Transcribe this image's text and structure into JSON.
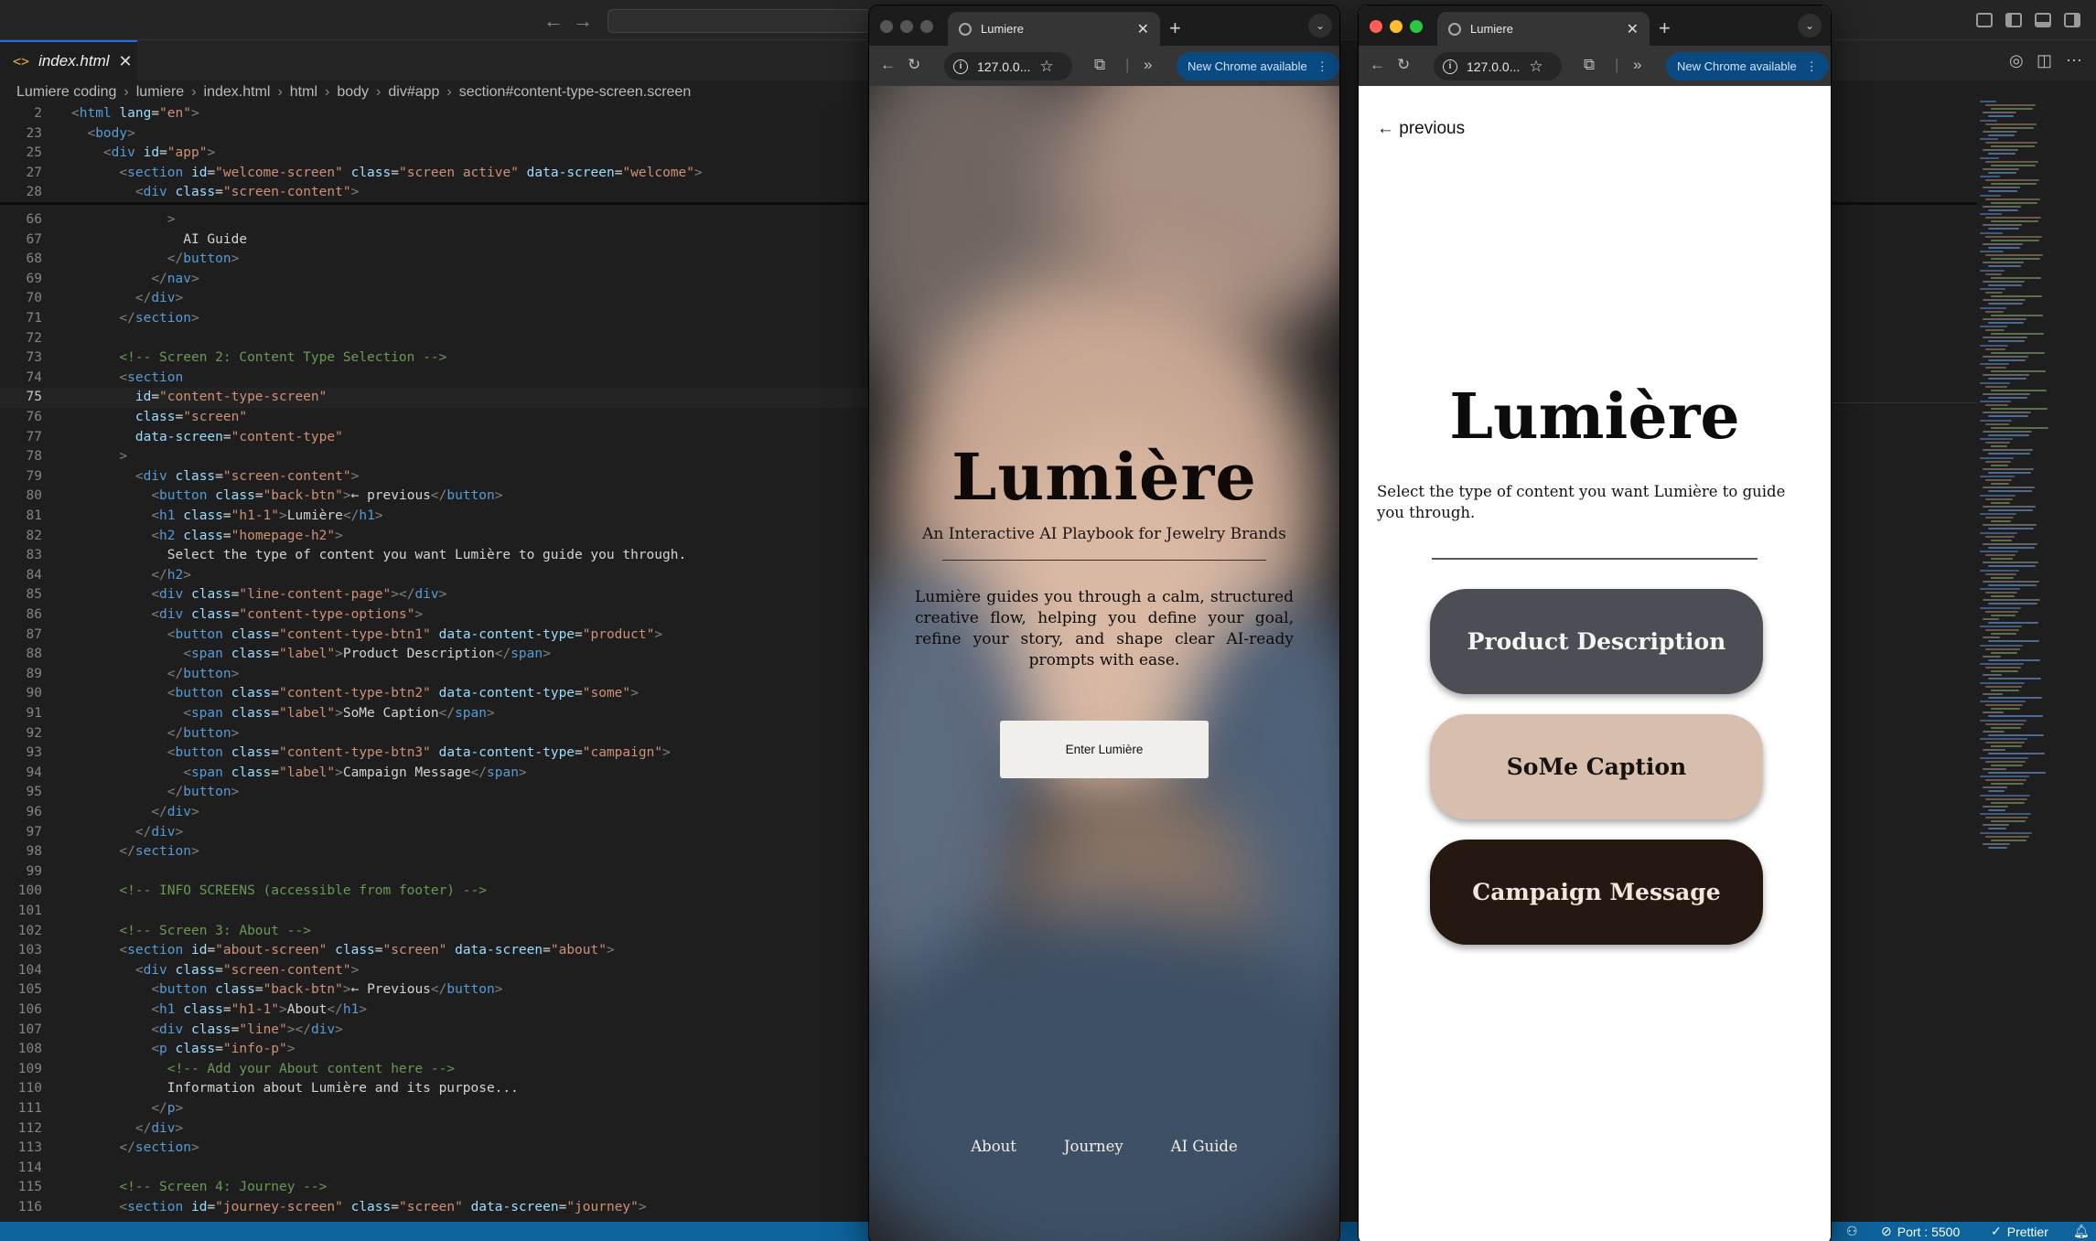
{
  "editor": {
    "tab_label": "index.html",
    "tab_file_icon": "<>",
    "tab_close": "✕",
    "breadcrumb": [
      "Lumiere coding",
      "lumiere",
      "index.html",
      "html",
      "body",
      "div#app",
      "section#content-type-screen.screen"
    ],
    "lines": [
      {
        "n": "2",
        "html": "<span class='t-pun'>&lt;</span><span class='t-tag'>html</span> <span class='t-attr'>lang</span>=<span class='t-str'>\"en\"</span><span class='t-pun'>&gt;</span>"
      },
      {
        "n": "23",
        "html": "  <span class='t-pun'>&lt;</span><span class='t-tag'>body</span><span class='t-pun'>&gt;</span>"
      },
      {
        "n": "25",
        "html": "    <span class='t-pun'>&lt;</span><span class='t-tag'>div</span> <span class='t-attr'>id</span>=<span class='t-str'>\"app\"</span><span class='t-pun'>&gt;</span>"
      },
      {
        "n": "27",
        "html": "      <span class='t-pun'>&lt;</span><span class='t-tag'>section</span> <span class='t-attr'>id</span>=<span class='t-str'>\"welcome-screen\"</span> <span class='t-attr'>class</span>=<span class='t-str'>\"screen active\"</span> <span class='t-attr'>data-screen</span>=<span class='t-str'>\"welcome\"</span><span class='t-pun'>&gt;</span>"
      },
      {
        "n": "28",
        "html": "        <span class='t-pun'>&lt;</span><span class='t-tag'>div</span> <span class='t-attr'>class</span>=<span class='t-str'>\"screen-content\"</span><span class='t-pun'>&gt;</span>"
      },
      {
        "n": "66",
        "html": "            <span class='t-pun'>&gt;</span>"
      },
      {
        "n": "67",
        "html": "              AI Guide"
      },
      {
        "n": "68",
        "html": "            <span class='t-pun'>&lt;/</span><span class='t-tag'>button</span><span class='t-pun'>&gt;</span>"
      },
      {
        "n": "69",
        "html": "          <span class='t-pun'>&lt;/</span><span class='t-tag'>nav</span><span class='t-pun'>&gt;</span>"
      },
      {
        "n": "70",
        "html": "        <span class='t-pun'>&lt;/</span><span class='t-tag'>div</span><span class='t-pun'>&gt;</span>"
      },
      {
        "n": "71",
        "html": "      <span class='t-pun'>&lt;/</span><span class='t-tag'>section</span><span class='t-pun'>&gt;</span>"
      },
      {
        "n": "72",
        "html": ""
      },
      {
        "n": "73",
        "html": "      <span class='t-com'>&lt;!-- Screen 2: Content Type Selection --&gt;</span>"
      },
      {
        "n": "74",
        "html": "      <span class='t-pun'>&lt;</span><span class='t-tag'>section</span>"
      },
      {
        "n": "75",
        "html": "        <span class='t-attr'>id</span>=<span class='t-str'>\"content-type-screen\"</span>",
        "current": true
      },
      {
        "n": "76",
        "html": "        <span class='t-attr'>class</span>=<span class='t-str'>\"screen\"</span>"
      },
      {
        "n": "77",
        "html": "        <span class='t-attr'>data-screen</span>=<span class='t-str'>\"content-type\"</span>"
      },
      {
        "n": "78",
        "html": "      <span class='t-pun'>&gt;</span>"
      },
      {
        "n": "79",
        "html": "        <span class='t-pun'>&lt;</span><span class='t-tag'>div</span> <span class='t-attr'>class</span>=<span class='t-str'>\"screen-content\"</span><span class='t-pun'>&gt;</span>"
      },
      {
        "n": "80",
        "html": "          <span class='t-pun'>&lt;</span><span class='t-tag'>button</span> <span class='t-attr'>class</span>=<span class='t-str'>\"back-btn\"</span><span class='t-pun'>&gt;</span>← previous<span class='t-pun'>&lt;/</span><span class='t-tag'>button</span><span class='t-pun'>&gt;</span>"
      },
      {
        "n": "81",
        "html": "          <span class='t-pun'>&lt;</span><span class='t-tag'>h1</span> <span class='t-attr'>class</span>=<span class='t-str'>\"h1-1\"</span><span class='t-pun'>&gt;</span>Lumière<span class='t-pun'>&lt;/</span><span class='t-tag'>h1</span><span class='t-pun'>&gt;</span>"
      },
      {
        "n": "82",
        "html": "          <span class='t-pun'>&lt;</span><span class='t-tag'>h2</span> <span class='t-attr'>class</span>=<span class='t-str'>\"homepage-h2\"</span><span class='t-pun'>&gt;</span>"
      },
      {
        "n": "83",
        "html": "            Select the type of content you want Lumière to guide you through."
      },
      {
        "n": "84",
        "html": "          <span class='t-pun'>&lt;/</span><span class='t-tag'>h2</span><span class='t-pun'>&gt;</span>"
      },
      {
        "n": "85",
        "html": "          <span class='t-pun'>&lt;</span><span class='t-tag'>div</span> <span class='t-attr'>class</span>=<span class='t-str'>\"line-content-page\"</span><span class='t-pun'>&gt;&lt;/</span><span class='t-tag'>div</span><span class='t-pun'>&gt;</span>"
      },
      {
        "n": "86",
        "html": "          <span class='t-pun'>&lt;</span><span class='t-tag'>div</span> <span class='t-attr'>class</span>=<span class='t-str'>\"content-type-options\"</span><span class='t-pun'>&gt;</span>"
      },
      {
        "n": "87",
        "html": "            <span class='t-pun'>&lt;</span><span class='t-tag'>button</span> <span class='t-attr'>class</span>=<span class='t-str'>\"content-type-btn1\"</span> <span class='t-attr'>data-content-type</span>=<span class='t-str'>\"product\"</span><span class='t-pun'>&gt;</span>"
      },
      {
        "n": "88",
        "html": "              <span class='t-pun'>&lt;</span><span class='t-tag'>span</span> <span class='t-attr'>class</span>=<span class='t-str'>\"label\"</span><span class='t-pun'>&gt;</span>Product Description<span class='t-pun'>&lt;/</span><span class='t-tag'>span</span><span class='t-pun'>&gt;</span>"
      },
      {
        "n": "89",
        "html": "            <span class='t-pun'>&lt;/</span><span class='t-tag'>button</span><span class='t-pun'>&gt;</span>"
      },
      {
        "n": "90",
        "html": "            <span class='t-pun'>&lt;</span><span class='t-tag'>button</span> <span class='t-attr'>class</span>=<span class='t-str'>\"content-type-btn2\"</span> <span class='t-attr'>data-content-type</span>=<span class='t-str'>\"some\"</span><span class='t-pun'>&gt;</span>"
      },
      {
        "n": "91",
        "html": "              <span class='t-pun'>&lt;</span><span class='t-tag'>span</span> <span class='t-attr'>class</span>=<span class='t-str'>\"label\"</span><span class='t-pun'>&gt;</span>SoMe Caption<span class='t-pun'>&lt;/</span><span class='t-tag'>span</span><span class='t-pun'>&gt;</span>"
      },
      {
        "n": "92",
        "html": "            <span class='t-pun'>&lt;/</span><span class='t-tag'>button</span><span class='t-pun'>&gt;</span>"
      },
      {
        "n": "93",
        "html": "            <span class='t-pun'>&lt;</span><span class='t-tag'>button</span> <span class='t-attr'>class</span>=<span class='t-str'>\"content-type-btn3\"</span> <span class='t-attr'>data-content-type</span>=<span class='t-str'>\"campaign\"</span><span class='t-pun'>&gt;</span>"
      },
      {
        "n": "94",
        "html": "              <span class='t-pun'>&lt;</span><span class='t-tag'>span</span> <span class='t-attr'>class</span>=<span class='t-str'>\"label\"</span><span class='t-pun'>&gt;</span>Campaign Message<span class='t-pun'>&lt;/</span><span class='t-tag'>span</span><span class='t-pun'>&gt;</span>"
      },
      {
        "n": "95",
        "html": "            <span class='t-pun'>&lt;/</span><span class='t-tag'>button</span><span class='t-pun'>&gt;</span>"
      },
      {
        "n": "96",
        "html": "          <span class='t-pun'>&lt;/</span><span class='t-tag'>div</span><span class='t-pun'>&gt;</span>"
      },
      {
        "n": "97",
        "html": "        <span class='t-pun'>&lt;/</span><span class='t-tag'>div</span><span class='t-pun'>&gt;</span>"
      },
      {
        "n": "98",
        "html": "      <span class='t-pun'>&lt;/</span><span class='t-tag'>section</span><span class='t-pun'>&gt;</span>"
      },
      {
        "n": "99",
        "html": ""
      },
      {
        "n": "100",
        "html": "      <span class='t-com'>&lt;!-- INFO SCREENS (accessible from footer) --&gt;</span>"
      },
      {
        "n": "101",
        "html": ""
      },
      {
        "n": "102",
        "html": "      <span class='t-com'>&lt;!-- Screen 3: About --&gt;</span>"
      },
      {
        "n": "103",
        "html": "      <span class='t-pun'>&lt;</span><span class='t-tag'>section</span> <span class='t-attr'>id</span>=<span class='t-str'>\"about-screen\"</span> <span class='t-attr'>class</span>=<span class='t-str'>\"screen\"</span> <span class='t-attr'>data-screen</span>=<span class='t-str'>\"about\"</span><span class='t-pun'>&gt;</span>"
      },
      {
        "n": "104",
        "html": "        <span class='t-pun'>&lt;</span><span class='t-tag'>div</span> <span class='t-attr'>class</span>=<span class='t-str'>\"screen-content\"</span><span class='t-pun'>&gt;</span>"
      },
      {
        "n": "105",
        "html": "          <span class='t-pun'>&lt;</span><span class='t-tag'>button</span> <span class='t-attr'>class</span>=<span class='t-str'>\"back-btn\"</span><span class='t-pun'>&gt;</span>← Previous<span class='t-pun'>&lt;/</span><span class='t-tag'>button</span><span class='t-pun'>&gt;</span>"
      },
      {
        "n": "106",
        "html": "          <span class='t-pun'>&lt;</span><span class='t-tag'>h1</span> <span class='t-attr'>class</span>=<span class='t-str'>\"h1-1\"</span><span class='t-pun'>&gt;</span>About<span class='t-pun'>&lt;/</span><span class='t-tag'>h1</span><span class='t-pun'>&gt;</span>"
      },
      {
        "n": "107",
        "html": "          <span class='t-pun'>&lt;</span><span class='t-tag'>div</span> <span class='t-attr'>class</span>=<span class='t-str'>\"line\"</span><span class='t-pun'>&gt;&lt;/</span><span class='t-tag'>div</span><span class='t-pun'>&gt;</span>"
      },
      {
        "n": "108",
        "html": "          <span class='t-pun'>&lt;</span><span class='t-tag'>p</span> <span class='t-attr'>class</span>=<span class='t-str'>\"info-p\"</span><span class='t-pun'>&gt;</span>"
      },
      {
        "n": "109",
        "html": "            <span class='t-com'>&lt;!-- Add your About content here --&gt;</span>"
      },
      {
        "n": "110",
        "html": "            Information about Lumière and its purpose..."
      },
      {
        "n": "111",
        "html": "          <span class='t-pun'>&lt;/</span><span class='t-tag'>p</span><span class='t-pun'>&gt;</span>"
      },
      {
        "n": "112",
        "html": "        <span class='t-pun'>&lt;/</span><span class='t-tag'>div</span><span class='t-pun'>&gt;</span>"
      },
      {
        "n": "113",
        "html": "      <span class='t-pun'>&lt;/</span><span class='t-tag'>section</span><span class='t-pun'>&gt;</span>"
      },
      {
        "n": "114",
        "html": ""
      },
      {
        "n": "115",
        "html": "      <span class='t-com'>&lt;!-- Screen 4: Journey --&gt;</span>"
      },
      {
        "n": "116",
        "html": "      <span class='t-pun'>&lt;</span><span class='t-tag'>section</span> <span class='t-attr'>id</span>=<span class='t-str'>\"journey-screen\"</span> <span class='t-attr'>class</span>=<span class='t-str'>\"screen\"</span> <span class='t-attr'>data-screen</span>=<span class='t-str'>\"journey\"</span><span class='t-pun'>&gt;</span>"
      }
    ]
  },
  "status_bar": {
    "port": "Port : 5500",
    "prettier": "Prettier"
  },
  "browser_welcome": {
    "tab_title": "Lumiere",
    "url": "127.0.0...",
    "update_chip": "New Chrome available",
    "title": "Lumière",
    "subtitle": "An Interactive AI Playbook for Jewelry Brands",
    "description": "Lumière guides you through a calm, structured creative flow, helping you define your goal, refine your story, and shape clear AI-ready prompts with ease.",
    "enter_label": "Enter Lumière",
    "footer": [
      "About",
      "Journey",
      "AI Guide"
    ]
  },
  "browser_content": {
    "tab_title": "Lumiere",
    "url": "127.0.0...",
    "update_chip": "New Chrome available",
    "back_label": "← previous",
    "title": "Lumière",
    "subtitle": "Select the type of content you want Lumière to guide you through.",
    "options": [
      "Product Description",
      "SoMe Caption",
      "Campaign Message"
    ]
  },
  "colors": {
    "product_button": "#4c4d55",
    "some_button": "#d8bfad",
    "campaign_button": "#241811",
    "status_bar": "#0e639c"
  }
}
